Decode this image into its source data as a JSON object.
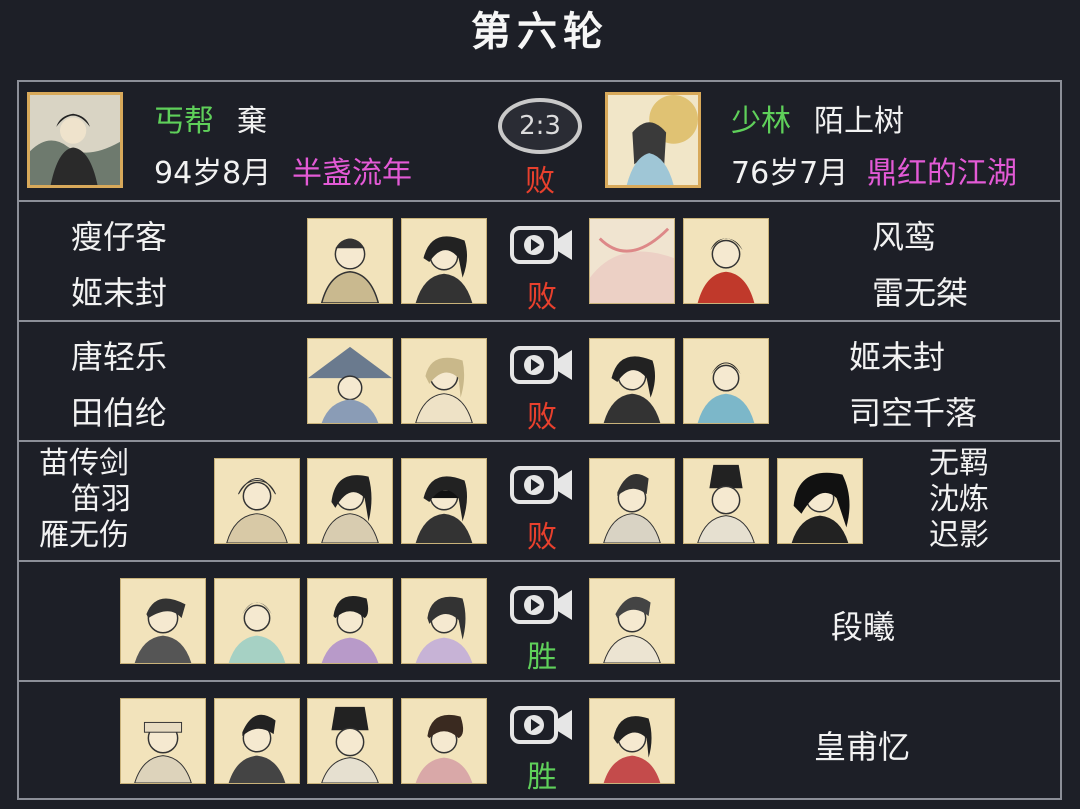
{
  "round_title": "第六轮",
  "header": {
    "left": {
      "sect": "丐帮",
      "name": "棄",
      "age": "94岁8月",
      "title": "半盏流年"
    },
    "right": {
      "sect": "少林",
      "name": "陌上树",
      "age": "76岁7月",
      "title": "鼎红的江湖"
    },
    "score": "2:3",
    "result": "败"
  },
  "matches": [
    {
      "left_players": [
        "瘦仔客",
        "姬末封"
      ],
      "right_players": [
        "风鸾",
        "雷无桀"
      ],
      "result": "败"
    },
    {
      "left_players": [
        "唐轻乐",
        "田伯纶"
      ],
      "right_players": [
        "姬未封",
        "司空千落"
      ],
      "result": "败"
    },
    {
      "left_players": [
        "苗传剑",
        "笛羽",
        "雁无伤"
      ],
      "right_players": [
        "无羁",
        "沈炼",
        "迟影"
      ],
      "result": "败"
    },
    {
      "left_players": [],
      "right_players": [
        "段曦"
      ],
      "result": "胜"
    },
    {
      "left_players": [],
      "right_players": [
        "皇甫忆"
      ],
      "result": "胜"
    }
  ],
  "colors": {
    "lose": "#e8402d",
    "win": "#5fd05a",
    "sect": "#5fd05a",
    "title_pink": "#e35ad6",
    "avatar_border": "#d8a95a"
  },
  "icons": {
    "replay": "video-camera-play-icon"
  }
}
